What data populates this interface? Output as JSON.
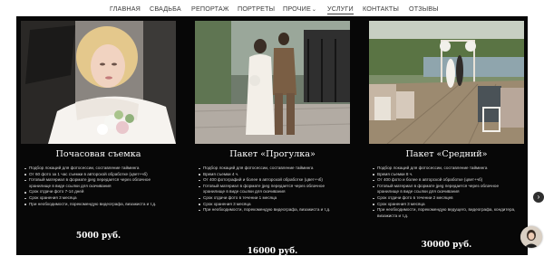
{
  "nav": {
    "items": [
      "ГЛАВНАЯ",
      "СВАДЬБА",
      "РЕПОРТАЖ",
      "ПОРТРЕТЫ",
      "ПРОЧИЕ",
      "УСЛУГИ",
      "КОНТАКТЫ",
      "ОТЗЫВЫ"
    ],
    "active": "УСЛУГИ",
    "dropdown": "ПРОЧИЕ"
  },
  "cards": [
    {
      "title": "Почасовая съемка",
      "image": "bride-in-car-with-bouquet",
      "features": [
        "Подбор локаций для фотосессии, составление тайминга",
        "От 60 фото за 1 час съемки в авторской обработке (цвет+чб)",
        "Готовый материал в формате jpeg передается через облачное хранилище в виде ссылки для скачивания",
        "Срок отдачи фото 7-14 дней",
        "Срок хранения 3 месяца",
        "При необходимости, порекомендую видеографа, визажиста и т.д."
      ],
      "price": "5000 руб."
    },
    {
      "title": "Пакет «Прогулка»",
      "image": "couple-walking-in-park",
      "features": [
        "Подбор локаций для фотосессии, составление тайминга",
        "Время съемки 4 ч.",
        "От 400 фотографий и более в авторской обработке (цвет+чб)",
        "Готовый материал в формате jpeg передается через облачное хранилище в виде ссылки для скачивания",
        "Срок отдачи фото в течении 1 месяца",
        "Срок хранения 3 месяца",
        "При необходимости, порекомендую видеографа, визажиста и т.д."
      ],
      "price": "16000 руб."
    },
    {
      "title": "Пакет «Средний»",
      "image": "outdoor-wedding-ceremony",
      "features": [
        "Подбор локаций для фотосессии, составление тайминга",
        "Время съемки 8 ч.",
        "От 400 фото и более в авторской обработке (цвет+чб)",
        "Готовый материал в формате jpeg передается через облачное хранилище в виде ссылки для скачивания",
        "Срок отдачи фото в течении 2 месяцев",
        "Срок хранения 3 месяца",
        "При необходимости, порекомендую ведущего, видеографа, кондитера, визажиста и т.д."
      ],
      "price": "30000 руб."
    }
  ],
  "widgets": {
    "scroll_icon": "arrow-right-icon",
    "avatar": "consultant-avatar"
  },
  "colors": {
    "section_bg": "#070707",
    "text": "#ffffff",
    "nav_text": "#3a3a3a"
  }
}
